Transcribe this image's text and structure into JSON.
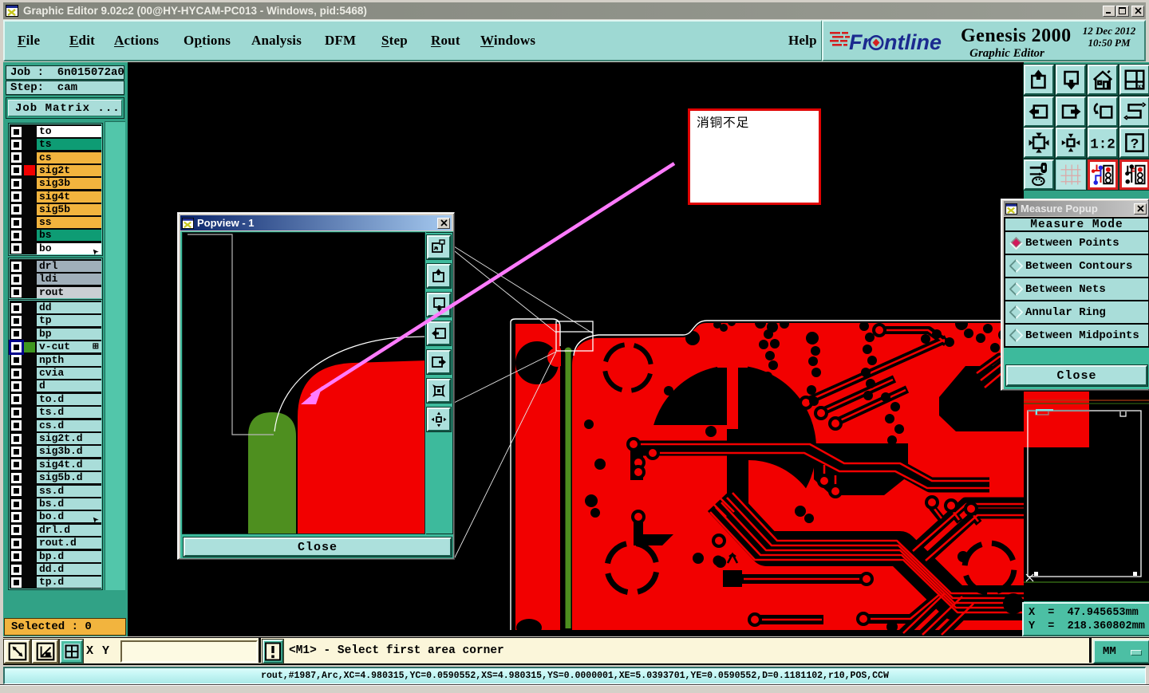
{
  "window": {
    "title": "Graphic Editor 9.02c2 (00@HY-HYCAM-PC013 - Windows, pid:5468)",
    "controls": [
      "minimize",
      "maximize",
      "close"
    ]
  },
  "menu": {
    "items": [
      {
        "label": "File",
        "underline": 0
      },
      {
        "label": "Edit",
        "underline": 0
      },
      {
        "label": "Actions",
        "underline": 0
      },
      {
        "label": "Options",
        "underline": 1
      },
      {
        "label": "Analysis",
        "underline": -1
      },
      {
        "label": "DFM",
        "underline": -1
      },
      {
        "label": "Step",
        "underline": 0
      },
      {
        "label": "Rout",
        "underline": 0
      },
      {
        "label": "Windows",
        "underline": 0
      }
    ],
    "help_label": "Help"
  },
  "brand": {
    "logo_text": "Frontline",
    "product": "Genesis 2000",
    "date": "12 Dec 2012",
    "time": "10:50 PM",
    "subtitle": "Graphic Editor",
    "logo_color": "#1B2A8F",
    "logo_accent": "#D42020"
  },
  "job_panel": {
    "job_line": "Job :  6n015072a0",
    "step_line": "Step:  cam",
    "matrix_button": "Job Matrix ..."
  },
  "layers": {
    "group1": [
      {
        "name": "to",
        "bg": "#FFFFFF"
      },
      {
        "name": "ts",
        "bg": "#0E9C74"
      },
      {
        "name": "cs",
        "bg": "#F2B43E"
      },
      {
        "name": "sig2t",
        "bg": "#F2B43E",
        "swatch": "#F20000"
      },
      {
        "name": "sig3b",
        "bg": "#F2B43E"
      },
      {
        "name": "sig4t",
        "bg": "#F2B43E"
      },
      {
        "name": "sig5b",
        "bg": "#F2B43E"
      },
      {
        "name": "ss",
        "bg": "#F2B43E"
      },
      {
        "name": "bs",
        "bg": "#0E9C74"
      },
      {
        "name": "bo",
        "bg": "#FFFFFF",
        "cursor": true
      }
    ],
    "group2": [
      {
        "name": "drl",
        "bg": "#A0AFBA"
      },
      {
        "name": "ldi",
        "bg": "#A0AFBA"
      },
      {
        "name": "rout",
        "bg": "#CBCFD4"
      }
    ],
    "group3": [
      {
        "name": "dd",
        "bg": "#A9DDD9"
      },
      {
        "name": "tp",
        "bg": "#A9DDD9"
      },
      {
        "name": "bp",
        "bg": "#A9DDD9"
      },
      {
        "name": "v-cut",
        "bg": "#A9DDD9",
        "swatch": "#3F9720",
        "cb_bg": "#00008B",
        "grid": true
      },
      {
        "name": "npth",
        "bg": "#A9DDD9"
      },
      {
        "name": "cvia",
        "bg": "#A9DDD9"
      },
      {
        "name": "d",
        "bg": "#A9DDD9"
      },
      {
        "name": "to.d",
        "bg": "#A9DDD9"
      },
      {
        "name": "ts.d",
        "bg": "#A9DDD9"
      },
      {
        "name": "cs.d",
        "bg": "#A9DDD9"
      },
      {
        "name": "sig2t.d",
        "bg": "#A9DDD9"
      },
      {
        "name": "sig3b.d",
        "bg": "#A9DDD9"
      },
      {
        "name": "sig4t.d",
        "bg": "#A9DDD9"
      },
      {
        "name": "sig5b.d",
        "bg": "#A9DDD9"
      },
      {
        "name": "ss.d",
        "bg": "#A9DDD9"
      },
      {
        "name": "bs.d",
        "bg": "#A9DDD9"
      },
      {
        "name": "bo.d",
        "bg": "#A9DDD9",
        "cursor": true
      },
      {
        "name": "drl.d",
        "bg": "#A9DDD9"
      },
      {
        "name": "rout.d",
        "bg": "#A9DDD9"
      },
      {
        "name": "bp.d",
        "bg": "#A9DDD9"
      },
      {
        "name": "dd.d",
        "bg": "#A9DDD9"
      },
      {
        "name": "tp.d",
        "bg": "#A9DDD9"
      }
    ]
  },
  "selected_bar": {
    "label": "Selected : 0"
  },
  "command_bar": {
    "icons": [
      "resize-diagonal-icon",
      "measure-angle-icon",
      "grid-window-icon"
    ],
    "xy_label": "X Y :",
    "xy_value": "",
    "alert_icon": "alert-icon",
    "message": "<M1> - Select first area corner",
    "units_value": "MM"
  },
  "status_bar": {
    "text": "rout,#1987,Arc,XC=4.980315,YC=0.0590552,XS=4.980315,YS=0.0000001,XE=5.0393701,YE=0.0590552,D=0.1181102,r10,POS,CCW"
  },
  "measure_popup": {
    "title": "Measure Popup",
    "header": "Measure Mode",
    "options": [
      {
        "label": "Between Points",
        "selected": true
      },
      {
        "label": "Between Contours",
        "selected": false
      },
      {
        "label": "Between Nets",
        "selected": false
      },
      {
        "label": "Annular Ring",
        "selected": false
      },
      {
        "label": "Between Midpoints",
        "selected": false
      }
    ],
    "close_label": "Close",
    "selected_color": "#D2195B"
  },
  "popview": {
    "title": "Popview - 1",
    "close_label": "Close",
    "toolbar_icons": [
      "open-copy-window-icon",
      "pan-up-icon",
      "pan-down-icon",
      "pan-left-icon",
      "pan-right-icon",
      "zoom-fit-icon",
      "pan-center-icon"
    ]
  },
  "right_toolbar": {
    "icons": [
      "pan-view-up",
      "pan-view-down",
      "home-view",
      "split-window-xy",
      "pan-view-left",
      "pan-view-right",
      "previous-view",
      "serpentine-route",
      "zoom-fit-board",
      "zoom-center",
      "scale-1-2",
      "help-query",
      "setup-tools",
      "grid-toggle",
      "net-compare-reference",
      "net-compare-current"
    ]
  },
  "overview_panel": {
    "x_readout": "X  =  47.945653mm",
    "y_readout": "Y  =  218.360802mm"
  },
  "annotation": {
    "text": "消铜不足"
  },
  "colors": {
    "pcb_copper": "#F20000",
    "pcb_vcut_green": "#4E8F1F",
    "arrow_magenta": "#FF7BFF",
    "teal_panel": "#31A286",
    "teal_light": "#9ED9D3",
    "cyan_box": "#A9DDD9",
    "cream": "#FBF6DA",
    "orange": "#F2B43E",
    "status_cyan": "#C5F6F5"
  }
}
